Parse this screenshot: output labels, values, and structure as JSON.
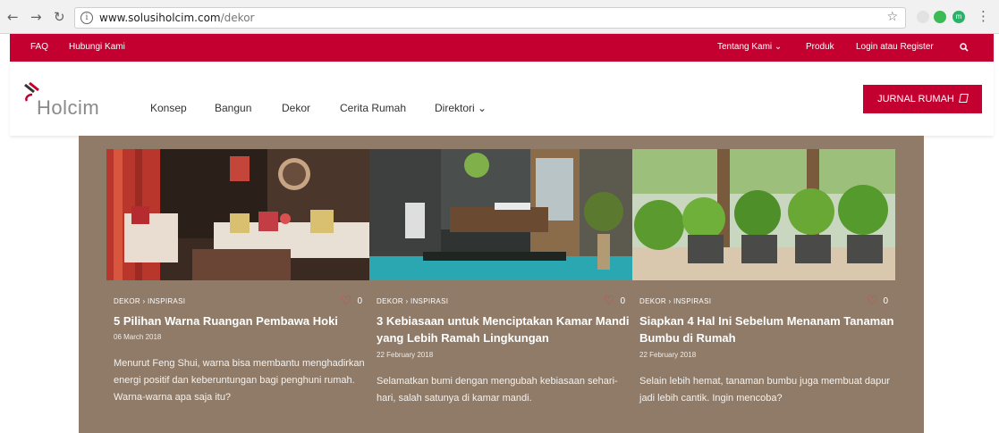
{
  "browser": {
    "url_host": "www.solusiholcim.com",
    "url_path": "/dekor",
    "ext_badge": "m"
  },
  "topbar": {
    "left": [
      "FAQ",
      "Hubungi Kami"
    ],
    "tentang": "Tentang Kami ⌄",
    "produk": "Produk",
    "login": "Login atau Register"
  },
  "header": {
    "logo": "Holcim",
    "nav": [
      "Konsep",
      "Bangun",
      "Dekor",
      "Cerita Rumah",
      "Direktori ⌄"
    ],
    "cta": "JURNAL RUMAH"
  },
  "cards": [
    {
      "category": "DEKOR › INSPIRASI",
      "likes": "0",
      "title": "5 Pilihan Warna Ruangan Pembawa Hoki",
      "date": "06 March 2018",
      "excerpt": "Menurut Feng Shui, warna bisa membantu menghadirkan energi positif dan keberuntungan bagi penghuni rumah. Warna-warna apa saja itu?"
    },
    {
      "category": "DEKOR › INSPIRASI",
      "likes": "0",
      "title": "3 Kebiasaan untuk Menciptakan Kamar Mandi yang Lebih Ramah Lingkungan",
      "date": "22 February 2018",
      "excerpt": "Selamatkan bumi dengan mengubah kebiasaan sehari-hari, salah satunya di kamar mandi."
    },
    {
      "category": "DEKOR › INSPIRASI",
      "likes": "0",
      "title": "Siapkan 4 Hal Ini Sebelum Menanam Tanaman Bumbu di Rumah",
      "date": "22 February 2018",
      "excerpt": "Selain lebih hemat, tanaman bumbu juga membuat dapur jadi lebih cantik. Ingin mencoba?"
    }
  ],
  "colors": {
    "brand_red": "#c3002f",
    "panel_brown": "#8f7b68"
  }
}
